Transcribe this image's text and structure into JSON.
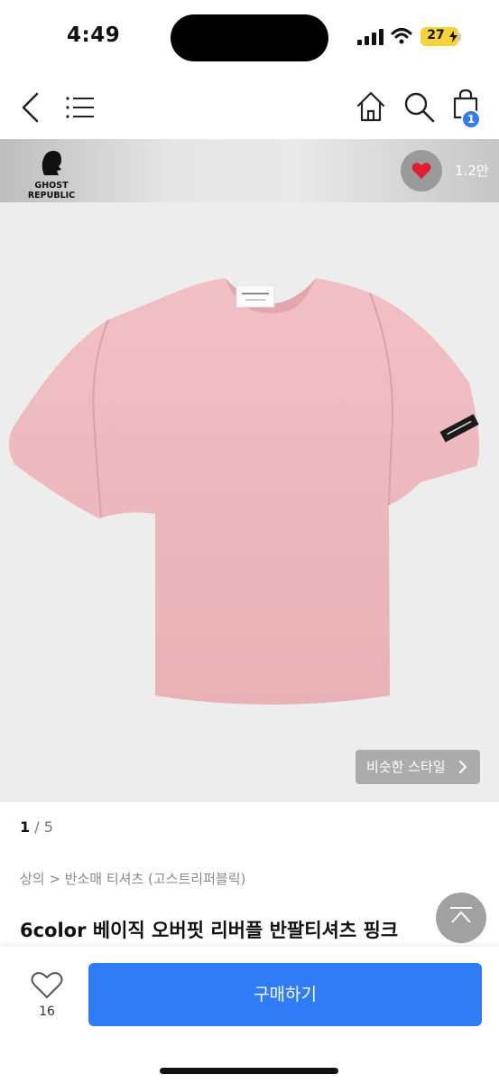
{
  "status_bar": {
    "time": "4:49",
    "battery": "27"
  },
  "nav": {
    "cart_badge": "1"
  },
  "brand": {
    "name_line1": "GHOST",
    "name_line2": "REPUBLIC",
    "like_count": "1.2만"
  },
  "product": {
    "similar_style_label": "비슷한 스타일",
    "image_current": "1",
    "image_total": "5",
    "category": "상의 > 반소매 티셔츠 (고스트리퍼블릭)",
    "title": "6color 베이직 오버핏 리버플 반팔티셔츠 핑크"
  },
  "bottom_bar": {
    "wish_count": "16",
    "buy_label": "구매하기"
  },
  "colors": {
    "accent": "#2f7cf6",
    "tshirt": "#eeb8bd",
    "heart": "#e11d2e"
  }
}
